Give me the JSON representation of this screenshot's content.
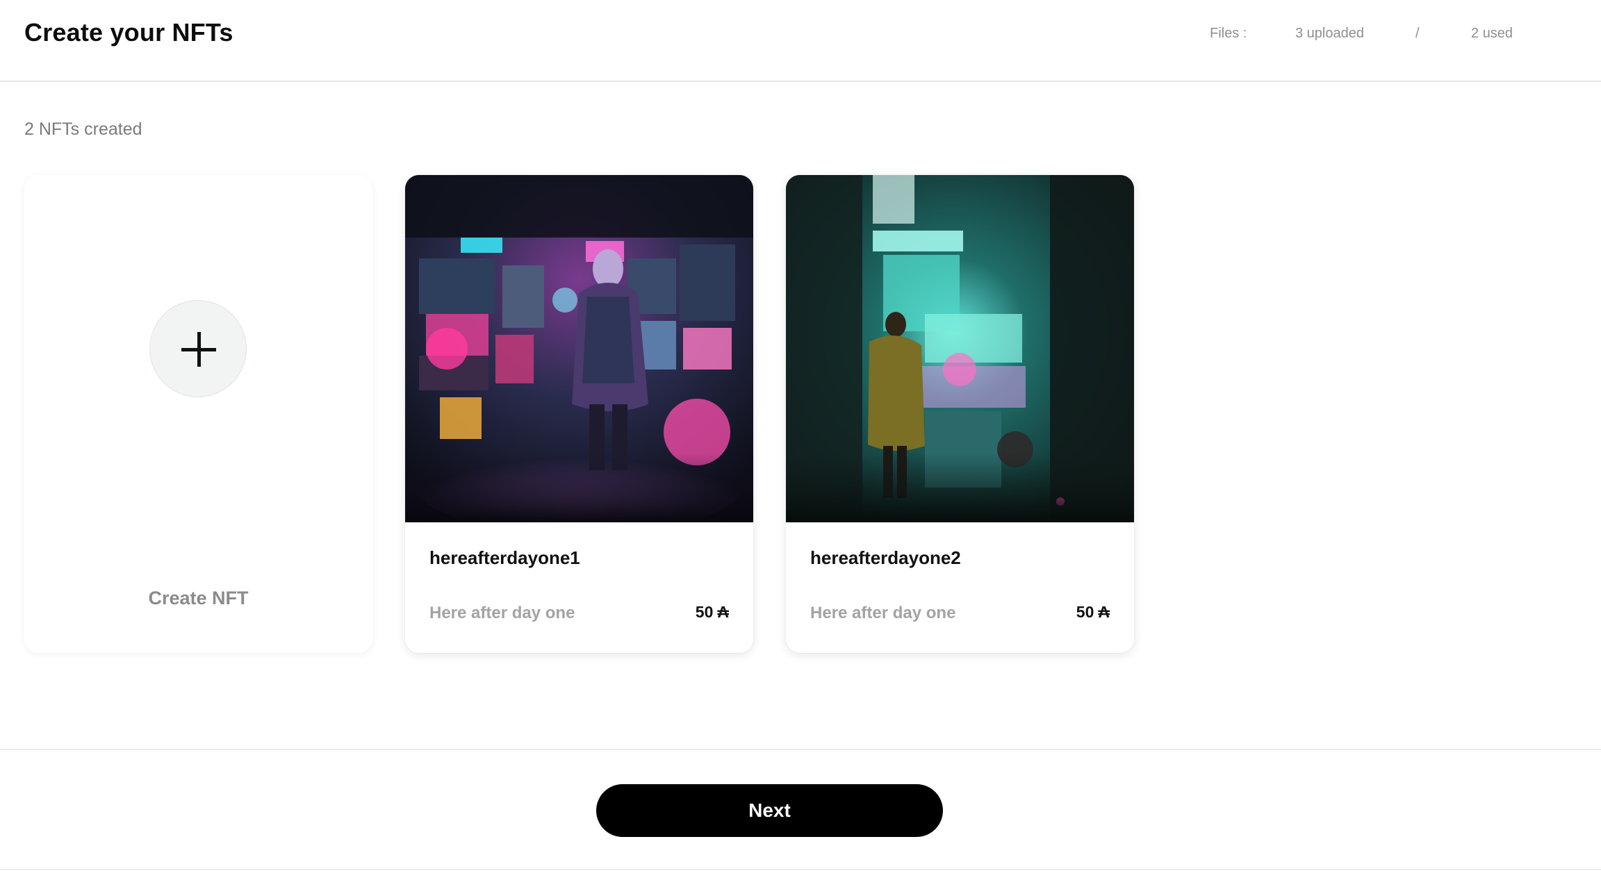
{
  "header": {
    "title": "Create your NFTs",
    "files_label": "Files :",
    "files_uploaded": "3 uploaded",
    "files_separator": "/",
    "files_used": "2 used"
  },
  "main": {
    "count_text": "2 NFTs created",
    "create_card": {
      "label": "Create NFT",
      "icon": "plus-icon"
    },
    "nfts": [
      {
        "name": "hereafterdayone1",
        "description": "Here after day one",
        "price": "50",
        "currency_icon": "₳",
        "image": "cyberpunk-figure-neon-magenta-shop"
      },
      {
        "name": "hereafterdayone2",
        "description": "Here after day one",
        "price": "50",
        "currency_icon": "₳",
        "image": "cyberpunk-figure-neon-teal-alley"
      }
    ]
  },
  "footer": {
    "next_label": "Next"
  },
  "colors": {
    "accent": "#000000",
    "muted_text": "#8b8b8b",
    "divider": "#e6e6e6"
  }
}
